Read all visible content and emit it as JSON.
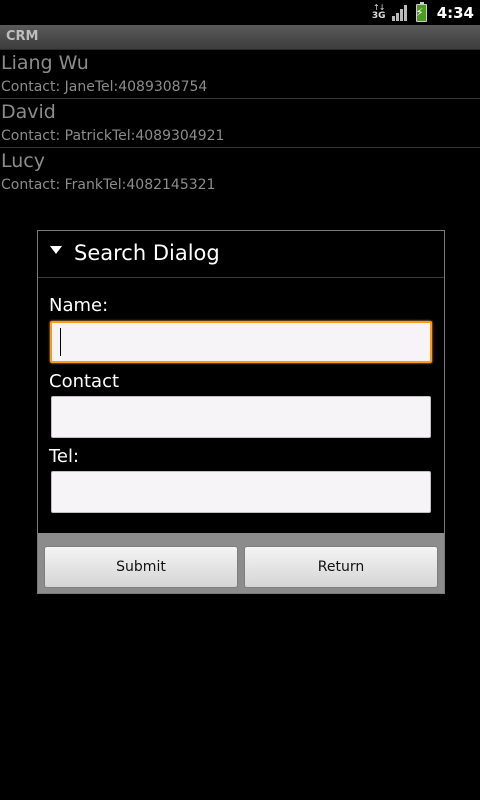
{
  "status_bar": {
    "network_label": "3G",
    "time": "4:34"
  },
  "title_bar": {
    "app_title": "CRM"
  },
  "contacts": [
    {
      "name": "Liang Wu",
      "detail": "Contact: JaneTel:4089308754"
    },
    {
      "name": "David",
      "detail": "Contact: PatrickTel:4089304921"
    },
    {
      "name": "Lucy",
      "detail": "Contact: FrankTel:4082145321"
    }
  ],
  "dialog": {
    "title": "Search Dialog",
    "name_label": "Name:",
    "name_value": "",
    "contact_label": "Contact",
    "contact_value": "",
    "tel_label": "Tel:",
    "tel_value": "",
    "submit_label": "Submit",
    "return_label": "Return"
  },
  "colors": {
    "focus_border": "#ff9a1a",
    "background": "#000000",
    "list_text": "#8c8c8c"
  }
}
